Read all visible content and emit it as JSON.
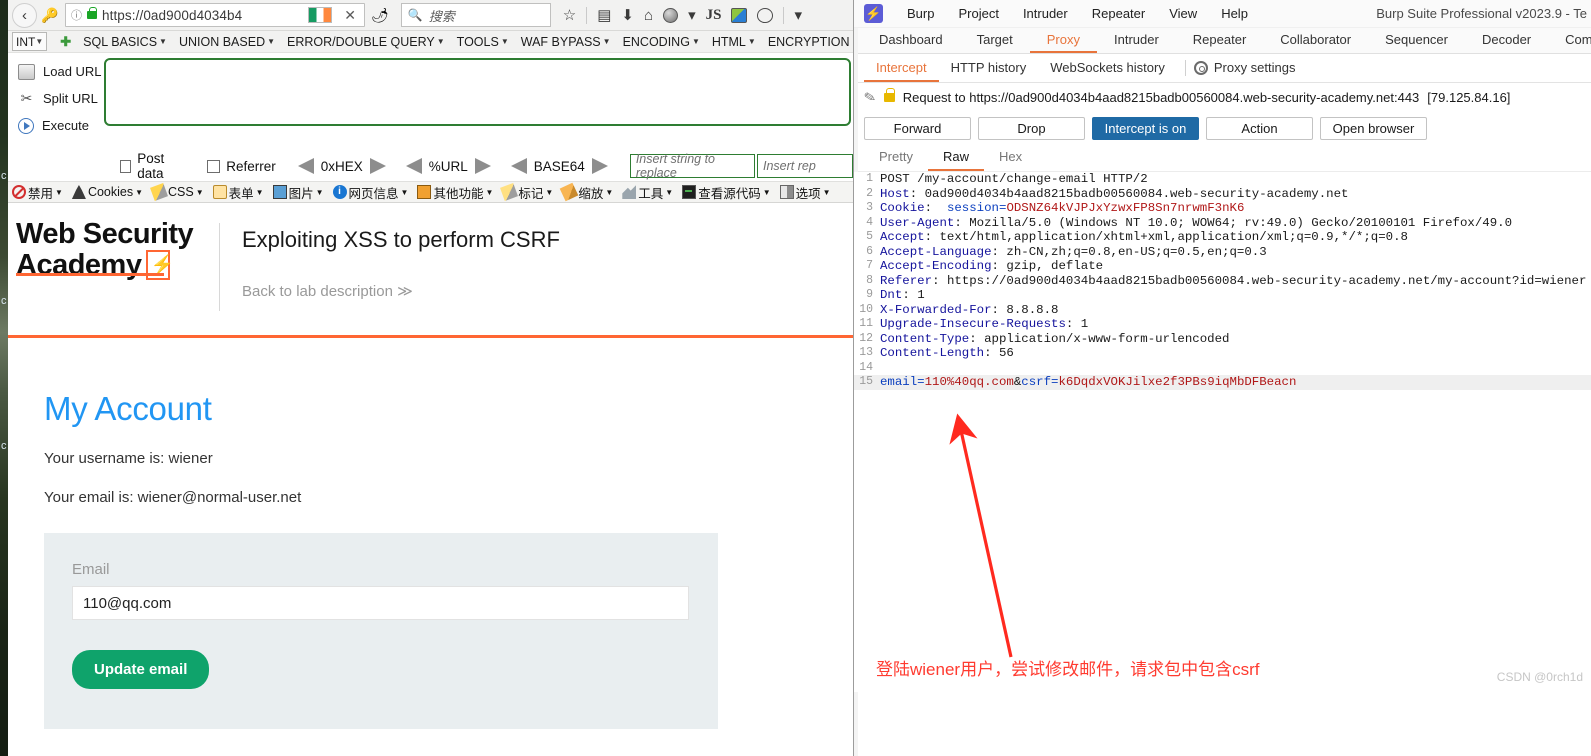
{
  "browser": {
    "url": "https://0ad900d4034b4",
    "search_placeholder": "搜索",
    "icons": {
      "back": "‹",
      "key": "key-icon",
      "info": "ⓘ",
      "close": "✕",
      "flame": "flame-icon",
      "magnifier": "⌕",
      "star": "☆",
      "library": "▤",
      "download": "⬇",
      "home": "⌂",
      "js": "JS",
      "caret": "▾"
    }
  },
  "hackbar": {
    "mode": "INT",
    "menus": [
      "SQL BASICS",
      "UNION BASED",
      "ERROR/DOUBLE QUERY",
      "TOOLS",
      "WAF BYPASS",
      "ENCODING",
      "HTML",
      "ENCRYPTION"
    ],
    "actions": [
      {
        "label": "Load URL",
        "icon": "load-url-icon"
      },
      {
        "label": "Split URL",
        "icon": "split-url-icon"
      },
      {
        "label": "Execute",
        "icon": "execute-icon"
      }
    ],
    "url_value": "",
    "checkboxes": [
      {
        "label": "Post data",
        "checked": false
      },
      {
        "label": "Referrer",
        "checked": false
      }
    ],
    "converters": [
      "0xHEX",
      "%URL",
      "BASE64"
    ],
    "replace_find_placeholder": "Insert string to replace",
    "replace_with_placeholder": "Insert rep",
    "chinese_menus": [
      {
        "label": "禁用",
        "icon": "ban-icon"
      },
      {
        "label": "Cookies",
        "icon": "cookie-icon"
      },
      {
        "label": "CSS",
        "icon": "css-icon"
      },
      {
        "label": "表单",
        "icon": "form-icon"
      },
      {
        "label": "图片",
        "icon": "image-icon"
      },
      {
        "label": "网页信息",
        "icon": "info-icon"
      },
      {
        "label": "其他功能",
        "icon": "misc-icon"
      },
      {
        "label": "标记",
        "icon": "marker-icon"
      },
      {
        "label": "缩放",
        "icon": "zoom-icon"
      },
      {
        "label": "工具",
        "icon": "tools-icon"
      },
      {
        "label": "查看源代码",
        "icon": "view-source-icon"
      },
      {
        "label": "选项",
        "icon": "options-icon"
      }
    ]
  },
  "lab": {
    "logo_line1": "Web Security",
    "logo_line2": "Academy",
    "title": "Exploiting XSS to perform CSRF",
    "back_link": "Back to lab description ≫",
    "heading": "My Account",
    "username_line": "Your username is: wiener",
    "email_line": "Your email is: wiener@normal-user.net",
    "form": {
      "label": "Email",
      "value": "110@qq.com",
      "submit": "Update email"
    },
    "colors": {
      "accent_orange": "#ff6633",
      "heading_blue": "#2196f3",
      "button_green": "#0fa36b"
    }
  },
  "burp": {
    "window_title": "Burp Suite Professional v2023.9 - Te",
    "menu": [
      "Burp",
      "Project",
      "Intruder",
      "Repeater",
      "View",
      "Help"
    ],
    "main_tabs": [
      "Dashboard",
      "Target",
      "Proxy",
      "Intruder",
      "Repeater",
      "Collaborator",
      "Sequencer",
      "Decoder",
      "Comp"
    ],
    "main_tab_active": "Proxy",
    "proxy_tabs": [
      "Intercept",
      "HTTP history",
      "WebSockets history"
    ],
    "proxy_tab_active": "Intercept",
    "proxy_settings": "Proxy settings",
    "request_to": "Request to https://0ad900d4034b4aad8215badb00560084.web-security-academy.net:443",
    "request_ip": "[79.125.84.16]",
    "buttons": [
      {
        "label": "Forward",
        "primary": false
      },
      {
        "label": "Drop",
        "primary": false
      },
      {
        "label": "Intercept is on",
        "primary": true
      },
      {
        "label": "Action",
        "primary": false
      },
      {
        "label": "Open browser",
        "primary": false
      }
    ],
    "message_tabs": [
      "Pretty",
      "Raw",
      "Hex"
    ],
    "message_tab_active": "Raw",
    "request_lines": [
      {
        "n": 1,
        "parts": [
          {
            "t": "POST /my-account/change-email HTTP/2",
            "c": "k-dark"
          }
        ]
      },
      {
        "n": 2,
        "parts": [
          {
            "t": "Host",
            "c": "k-navy"
          },
          {
            "t": ": ",
            "c": "k-dark"
          },
          {
            "t": "0ad900d4034b4aad8215badb00560084.web-security-academy.net",
            "c": "k-dark"
          }
        ]
      },
      {
        "n": 3,
        "parts": [
          {
            "t": "Cookie",
            "c": "k-navy"
          },
          {
            "t": ":  ",
            "c": "k-dark"
          },
          {
            "t": "session=",
            "c": "k-blue"
          },
          {
            "t": "ODSNZ64kVJPJxYzwxFP8Sn7nrwmF3nK6",
            "c": "k-red"
          }
        ]
      },
      {
        "n": 4,
        "parts": [
          {
            "t": "User-Agent",
            "c": "k-navy"
          },
          {
            "t": ": ",
            "c": "k-dark"
          },
          {
            "t": "Mozilla/5.0 (Windows NT 10.0; WOW64; rv:49.0) Gecko/20100101 Firefox/49.0",
            "c": "k-dark"
          }
        ]
      },
      {
        "n": 5,
        "parts": [
          {
            "t": "Accept",
            "c": "k-navy"
          },
          {
            "t": ": ",
            "c": "k-dark"
          },
          {
            "t": "text/html,application/xhtml+xml,application/xml;q=0.9,*/*;q=0.8",
            "c": "k-dark"
          }
        ]
      },
      {
        "n": 6,
        "parts": [
          {
            "t": "Accept-Language",
            "c": "k-navy"
          },
          {
            "t": ": ",
            "c": "k-dark"
          },
          {
            "t": "zh-CN,zh;q=0.8,en-US;q=0.5,en;q=0.3",
            "c": "k-dark"
          }
        ]
      },
      {
        "n": 7,
        "parts": [
          {
            "t": "Accept-Encoding",
            "c": "k-navy"
          },
          {
            "t": ": ",
            "c": "k-dark"
          },
          {
            "t": "gzip, deflate",
            "c": "k-dark"
          }
        ]
      },
      {
        "n": 8,
        "parts": [
          {
            "t": "Referer",
            "c": "k-navy"
          },
          {
            "t": ": ",
            "c": "k-dark"
          },
          {
            "t": "https://0ad900d4034b4aad8215badb00560084.web-security-academy.net/my-account?id=wiener",
            "c": "k-dark"
          }
        ]
      },
      {
        "n": 9,
        "parts": [
          {
            "t": "Dnt",
            "c": "k-navy"
          },
          {
            "t": ": ",
            "c": "k-dark"
          },
          {
            "t": "1",
            "c": "k-dark"
          }
        ]
      },
      {
        "n": 10,
        "parts": [
          {
            "t": "X-Forwarded-For",
            "c": "k-navy"
          },
          {
            "t": ": ",
            "c": "k-dark"
          },
          {
            "t": "8.8.8.8",
            "c": "k-dark"
          }
        ]
      },
      {
        "n": 11,
        "parts": [
          {
            "t": "Upgrade-Insecure-Requests",
            "c": "k-navy"
          },
          {
            "t": ": ",
            "c": "k-dark"
          },
          {
            "t": "1",
            "c": "k-dark"
          }
        ]
      },
      {
        "n": 12,
        "parts": [
          {
            "t": "Content-Type",
            "c": "k-navy"
          },
          {
            "t": ": ",
            "c": "k-dark"
          },
          {
            "t": "application/x-www-form-urlencoded",
            "c": "k-dark"
          }
        ]
      },
      {
        "n": 13,
        "parts": [
          {
            "t": "Content-Length",
            "c": "k-navy"
          },
          {
            "t": ": ",
            "c": "k-dark"
          },
          {
            "t": "56",
            "c": "k-dark"
          }
        ]
      },
      {
        "n": 14,
        "parts": [
          {
            "t": "",
            "c": "k-dark"
          }
        ]
      },
      {
        "n": 15,
        "hl": true,
        "parts": [
          {
            "t": "email=",
            "c": "k-blue"
          },
          {
            "t": "110%40qq.com",
            "c": "k-red"
          },
          {
            "t": "&",
            "c": "k-dark"
          },
          {
            "t": "csrf=",
            "c": "k-blue"
          },
          {
            "t": "k6DqdxVOKJilxe2f3PBs9iqMbDFBeacn",
            "c": "k-red"
          }
        ]
      }
    ],
    "annotation": "登陆wiener用户，尝试修改邮件，请求包中包含csrf",
    "watermark": "CSDN @0rch1d",
    "colors": {
      "accent": "#e8743b",
      "primary_button": "#1f6aa5",
      "annotation": "#ff3b30"
    }
  }
}
